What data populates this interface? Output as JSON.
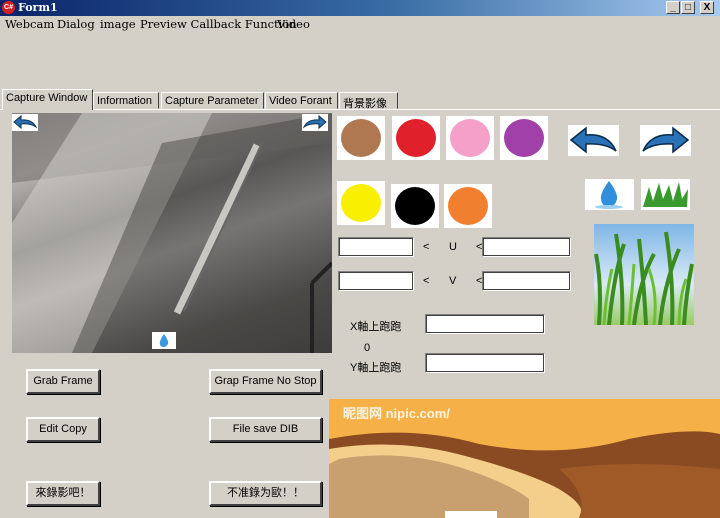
{
  "window": {
    "title": "Form1",
    "minimize": "_",
    "maximize": "□",
    "close": "X"
  },
  "menu": [
    "Webcam",
    "Dialog",
    "image",
    "Preview Callback Function",
    "Video"
  ],
  "tabs": [
    "Capture Window",
    "Information",
    "Capture Parameter",
    "Video Forant",
    "背景影像"
  ],
  "active_tab": 0,
  "buttons": {
    "grab_frame": "Grab Frame",
    "grab_frame_no_stop": "Grap Frame No Stop",
    "edit_copy": "Edit Copy",
    "file_save_dib": "File save DIB",
    "record": "來錄影吧！",
    "stop_record": "不准錄为歐！！"
  },
  "colors": [
    "#b07850",
    "#e0202a",
    "#f4a0c8",
    "#a040a8",
    "#f8f000",
    "#000000",
    "#f08030"
  ],
  "u_row": {
    "left_value": "",
    "lt1": "<",
    "label": "U",
    "lt2": "<",
    "right_value": ""
  },
  "v_row": {
    "left_value": "",
    "lt1": "<",
    "label": "V",
    "lt2": "<",
    "right_value": ""
  },
  "x_axis": {
    "label": "X軸上跑跑",
    "value": ""
  },
  "y_axis": {
    "label": "Y軸上跑跑",
    "value": ""
  },
  "zero_label": "0",
  "banner_watermark": "昵图网 nipic.com/"
}
